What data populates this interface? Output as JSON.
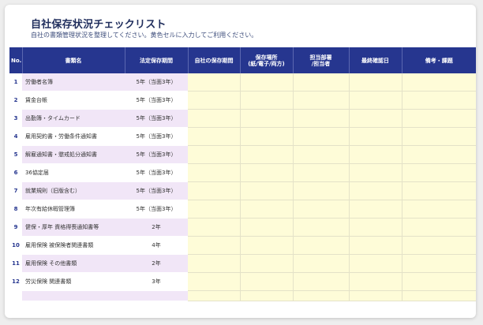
{
  "header": {
    "title": "自社保存状況チェックリスト",
    "subtitle": "自社の書類管理状況を整理してください。黄色セルに入力してご利用ください。"
  },
  "table": {
    "columns": {
      "no": "No.",
      "name": "書類名",
      "period": "法定保存期間",
      "own_period": "自社の保存期間",
      "location": "保存場所\n(紙/電子/両方)",
      "dept": "担当部署\n/担当者",
      "last_check": "最終確認日",
      "notes": "備考・課題"
    },
    "rows": [
      {
        "no": "1",
        "name": "労働者名簿",
        "period": "5年（当面3年）"
      },
      {
        "no": "2",
        "name": "賃金台帳",
        "period": "5年（当面3年）"
      },
      {
        "no": "3",
        "name": "出勤簿・タイムカード",
        "period": "5年（当面3年）"
      },
      {
        "no": "4",
        "name": "雇用契約書・労働条件通知書",
        "period": "5年（当面3年）"
      },
      {
        "no": "5",
        "name": "解雇通知書・懲戒処分通知書",
        "period": "5年（当面3年）"
      },
      {
        "no": "6",
        "name": "36協定届",
        "period": "5年（当面3年）"
      },
      {
        "no": "7",
        "name": "就業規則（旧版含む）",
        "period": "5年（当面3年）"
      },
      {
        "no": "8",
        "name": "年次有給休暇管理簿",
        "period": "5年（当面3年）"
      },
      {
        "no": "9",
        "name": "健保・厚年 資格得喪通知書等",
        "period": "2年"
      },
      {
        "no": "10",
        "name": "雇用保険 被保険者関連書類",
        "period": "4年"
      },
      {
        "no": "11",
        "name": "雇用保険 その他書類",
        "period": "2年"
      },
      {
        "no": "12",
        "name": "労災保険 関連書類",
        "period": "3年"
      }
    ]
  },
  "colors": {
    "header_bg": "#26368f",
    "title": "#1f2d5c",
    "name_band": "#f1e6f7",
    "input_cell": "#fefcd8"
  }
}
